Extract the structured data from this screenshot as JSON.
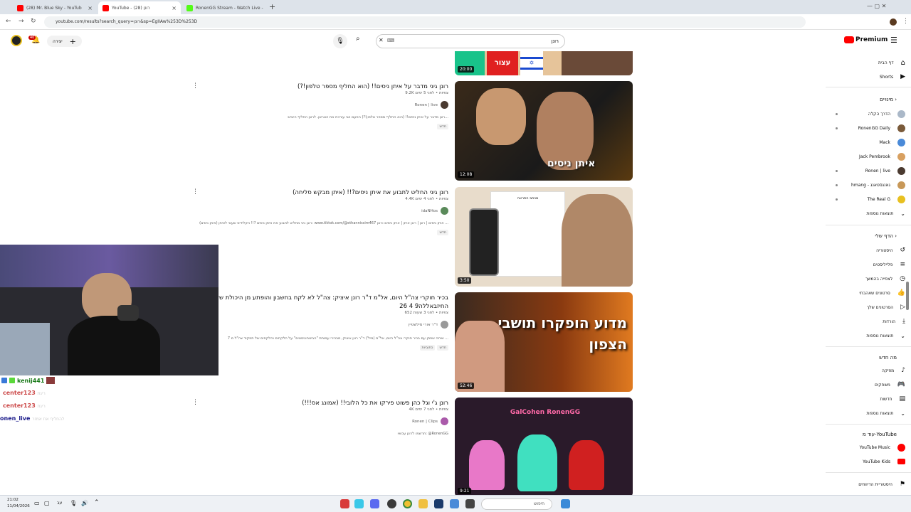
{
  "browser": {
    "tabs": [
      {
        "label": "(28) Mr. Blue Sky - YouTub",
        "active": false
      },
      {
        "label": "YouTube - רונן (28)",
        "active": true
      },
      {
        "label": "RonenGG Stream - Watch Live -",
        "active": false
      }
    ],
    "url": "youtube.com/results?search_query=רונן&sp=EgIIAw%253D%253D"
  },
  "header": {
    "create_label": "יצירה",
    "notifications_count": "40",
    "search_value": "רונן",
    "logo": "Premium"
  },
  "videos": [
    {
      "title": "רונן גיגי מדבר על איתן ניסים!! (הוא החליף מספר טלפון!?)",
      "meta": "9.2K צפיות • לפני 5 ימים",
      "channel": "Ronen | live",
      "desc": "רונן מדבר על איתן ניסים!! (הוא החליף מספר טלפון!?) הפעם אני עורכת את הטרשן. לרונן החליף היטייב...",
      "badge": "חדש",
      "duration": "12:08",
      "thumb_text": "איתן ניסים"
    },
    {
      "title": "רונן גיגי החליט לתבוע את איתן ניסים?!! (איתן מבקש סליחה)",
      "meta": "4.4K צפיות • לפני 4 ימים",
      "channel": "idaNHos",
      "desc": "רונן גיגי מחליט לתבוע את איתן ניסים ?!! הקלידיס שעטי לאיתן (איתן ניסים): www.tiktok.com/@ethannissim467 איתן ניסים | רונן | רונן איתן | איתן ניסים ורונן ...",
      "badge": "חדש",
      "duration": "3:50",
      "thumb_text": "מכתב התראה"
    },
    {
      "title": "בכיר חוקרי צה\"ל היום, אל\"מ ד\"ר רונן איציק: צה\"ל לא לקח בחשבון והופתע מן היכולת של החיזבאללה9 4 26",
      "meta": "652 צפיות • לפני 3 שעות",
      "channel": "ד\"ר אורי מילשטיין",
      "desc": "שיחה שפתן עם בכיר חוקרי צה\"ל היום, אל\"מ (מיל') ד\"ר רונן איציק, מבכירי עמותת \"הביטחוניסטים\" על הלקחים והלקחים של תפקוד צה\"ל מ 7 ...",
      "badge": "חדש",
      "badge2": "כתוביות",
      "duration": "52:46",
      "thumb_text": "מדוע הופקרו תושבי הצפון"
    },
    {
      "title": "רונן ג'י וגל כהן פשוט פירקו את כל הלובי!! (אמונג אס!!!)",
      "meta": "4K צפיות • לפני 7 ימים",
      "channel": "Ronen | Clips",
      "desc": "תרשמו לרונן עכשיו: @RonenGG",
      "badge": "",
      "duration": "9:21",
      "thumb_text": "GalCohen RonenGG"
    }
  ],
  "top_thumb": {
    "duration": "20:00",
    "badge": "עצור"
  },
  "sidebar": {
    "items": [
      {
        "label": "דף הבית"
      },
      {
        "label": "Shorts"
      }
    ],
    "subs_header": "מינויים",
    "subs": [
      {
        "label": "הדרך הקלה",
        "color": "#aab8c8"
      },
      {
        "label": "RonenGG Daily",
        "color": "#7a5a3a"
      },
      {
        "label": "Mack",
        "color": "#4a8ad8"
      },
      {
        "label": "Jack Pembrook",
        "color": "#d8a060"
      },
      {
        "label": "Ronen | live",
        "color": "#4a3a30"
      },
      {
        "label": "hmang - גאנגסטאנג",
        "color": "#c89858"
      },
      {
        "label": "The Real G",
        "color": "#e8c020"
      },
      {
        "label": "תוצאות נוספות",
        "color": ""
      }
    ],
    "you_header": "הדף שלי",
    "you": [
      {
        "label": "היסטוריה"
      },
      {
        "label": "פלייליסטים"
      },
      {
        "label": "לצפייה בהמשך"
      },
      {
        "label": "סרטונים שאהבתי"
      },
      {
        "label": "הסרטונים שלך"
      },
      {
        "label": "הורדות"
      },
      {
        "label": "תוצאות נוספות"
      }
    ],
    "explore_header": "מה חדש",
    "explore": [
      {
        "label": "מוזיקה"
      },
      {
        "label": "משחקים"
      },
      {
        "label": "חדשות"
      },
      {
        "label": "תוצאות נוספות"
      }
    ],
    "more_header": "עוד מ-YouTube",
    "more": [
      {
        "label": "YouTube Music"
      },
      {
        "label": "YouTube Kids"
      }
    ],
    "bottom": "היסטוריית הדיווחים"
  },
  "chat": [
    {
      "name": "kenij441",
      "msg": "",
      "color": "#1a7a1a"
    },
    {
      "name": "center123",
      "msg": "ריגת",
      "color": "#cc4a4a"
    },
    {
      "name": "center123",
      "msg": "ריגת",
      "color": "#cc4a4a"
    },
    {
      "name": "onen_live",
      "msg": "להחליף את אמזר",
      "color": "#1a1a8a"
    }
  ],
  "taskbar": {
    "time": "21:02",
    "date": "11/04/2026",
    "lang": "עב",
    "search_placeholder": "חיפוש"
  },
  "colors": {
    "accent": "#ff0000",
    "tabbar": "#dde3ea"
  }
}
